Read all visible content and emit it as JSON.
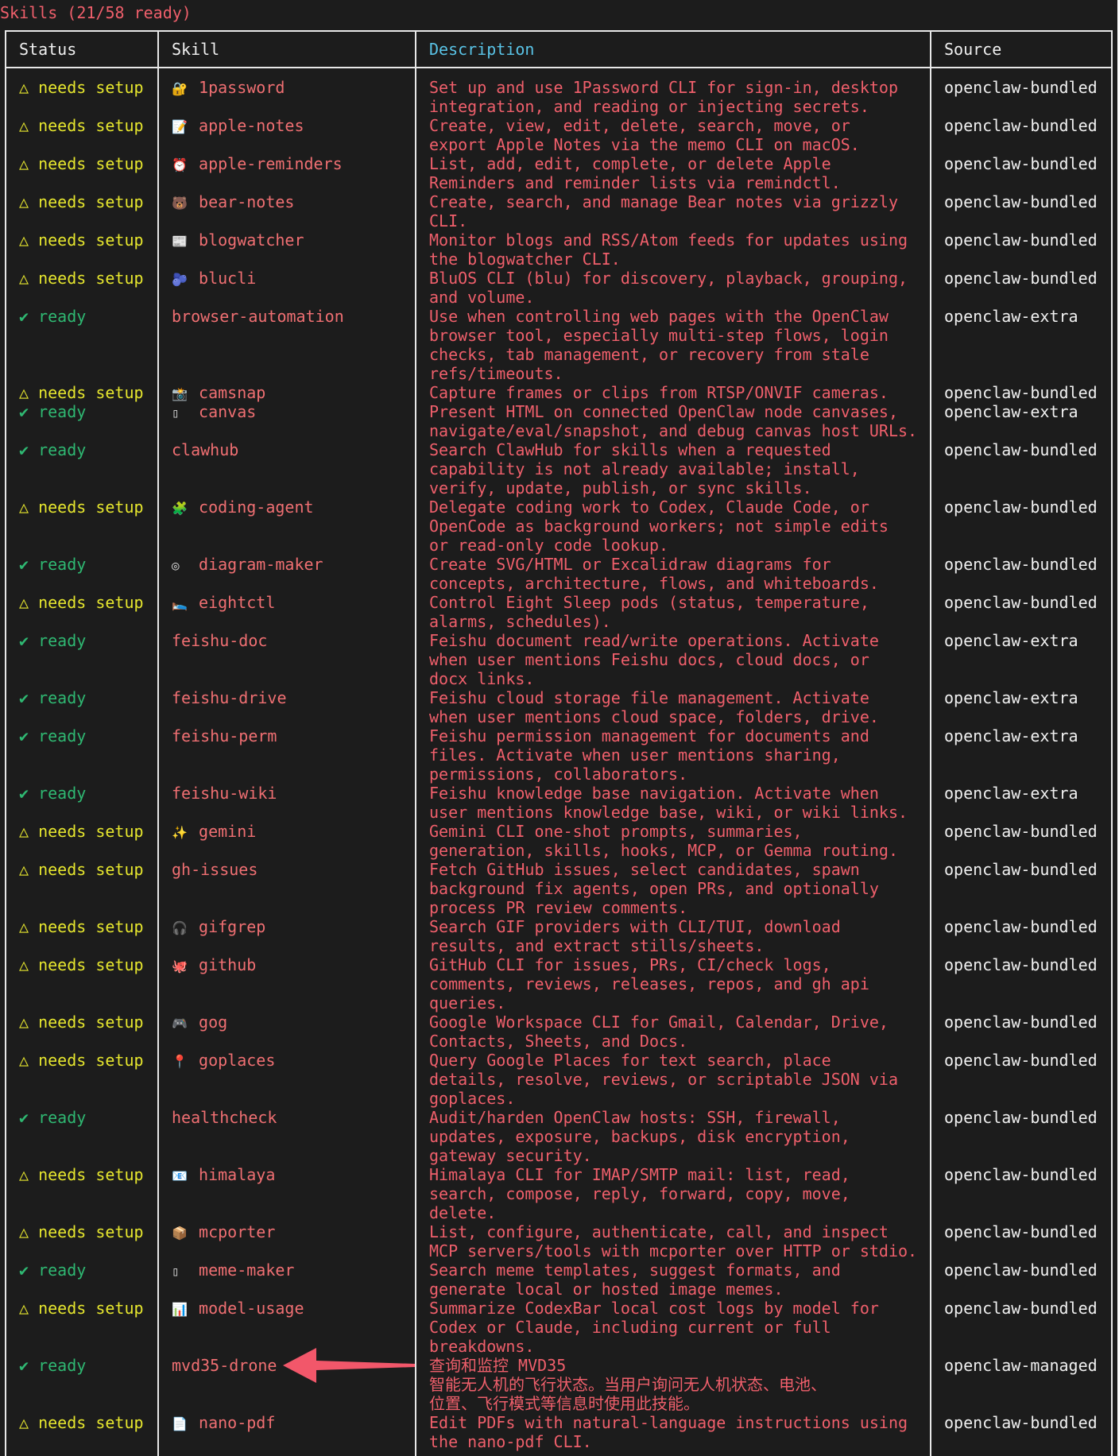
{
  "title": "Skills (21/58 ready)",
  "colors": {
    "ready": "#2fb872",
    "setup": "#e6e62e",
    "text_red": "#ef5f6b",
    "header_blue": "#59c3e6",
    "white": "#f0f0f0"
  },
  "headers": {
    "status": "Status",
    "skill": "Skill",
    "description": "Description",
    "source": "Source"
  },
  "rows": [
    {
      "status": "△ needs setup",
      "icon": "🔐",
      "icon_name": "lock-key-icon",
      "skill": "1password",
      "desc": "Set up and use 1Password CLI for sign-in, desktop\nintegration, and reading or injecting secrets.",
      "source": "openclaw-bundled"
    },
    {
      "status": "△ needs setup",
      "icon": "📝",
      "icon_name": "memo-icon",
      "skill": "apple-notes",
      "desc": "Create, view, edit, delete, search, move, or\nexport Apple Notes via the memo CLI on macOS.",
      "source": "openclaw-bundled"
    },
    {
      "status": "△ needs setup",
      "icon": "⏰",
      "icon_name": "alarm-clock-icon",
      "skill": "apple-reminders",
      "desc": "List, add, edit, complete, or delete Apple\nReminders and reminder lists via remindctl.",
      "source": "openclaw-bundled"
    },
    {
      "status": "△ needs setup",
      "icon": "🐻",
      "icon_name": "bear-icon",
      "skill": "bear-notes",
      "desc": "Create, search, and manage Bear notes via grizzly\nCLI.",
      "source": "openclaw-bundled"
    },
    {
      "status": "△ needs setup",
      "icon": "📰",
      "icon_name": "newspaper-icon",
      "skill": "blogwatcher",
      "desc": "Monitor blogs and RSS/Atom feeds for updates using\nthe blogwatcher CLI.",
      "source": "openclaw-bundled"
    },
    {
      "status": "△ needs setup",
      "icon": "🫐",
      "icon_name": "blueberries-icon",
      "skill": "blucli",
      "desc": "BluOS CLI (blu) for discovery, playback, grouping,\nand volume.",
      "source": "openclaw-bundled"
    },
    {
      "status": "✔ ready",
      "icon": "",
      "icon_name": "",
      "skill": "browser-automation",
      "desc": "Use when controlling web pages with the OpenClaw\nbrowser tool, especially multi-step flows, login\nchecks, tab management, or recovery from stale\nrefs/timeouts.",
      "source": "openclaw-extra"
    },
    {
      "status": "△ needs setup",
      "icon": "📸",
      "icon_name": "camera-icon",
      "skill": "camsnap",
      "desc": "Capture frames or clips from RTSP/ONVIF cameras.",
      "source": "openclaw-bundled"
    },
    {
      "status": "✔ ready",
      "icon": "▯",
      "icon_name": "canvas-icon",
      "skill": "canvas",
      "desc": "Present HTML on connected OpenClaw node canvases,\nnavigate/eval/snapshot, and debug canvas host URLs.",
      "source": "openclaw-extra"
    },
    {
      "status": "✔ ready",
      "icon": "",
      "icon_name": "",
      "skill": "clawhub",
      "desc": "Search ClawHub for skills when a requested\ncapability is not already available; install,\nverify, update, publish, or sync skills.",
      "source": "openclaw-bundled"
    },
    {
      "status": "△ needs setup",
      "icon": "🧩",
      "icon_name": "puzzle-icon",
      "skill": "coding-agent",
      "desc": "Delegate coding work to Codex, Claude Code, or\nOpenCode as background workers; not simple edits\nor read-only code lookup.",
      "source": "openclaw-bundled"
    },
    {
      "status": "✔ ready",
      "icon": "◎",
      "icon_name": "target-icon",
      "skill": "diagram-maker",
      "desc": "Create SVG/HTML or Excalidraw diagrams for\nconcepts, architecture, flows, and whiteboards.",
      "source": "openclaw-bundled"
    },
    {
      "status": "△ needs setup",
      "icon": "🛌",
      "icon_name": "bed-icon",
      "skill": "eightctl",
      "desc": "Control Eight Sleep pods (status, temperature,\nalarms, schedules).",
      "source": "openclaw-bundled"
    },
    {
      "status": "✔ ready",
      "icon": "",
      "icon_name": "",
      "skill": "feishu-doc",
      "desc": "Feishu document read/write operations. Activate\nwhen user mentions Feishu docs, cloud docs, or\ndocx links.",
      "source": "openclaw-extra"
    },
    {
      "status": "✔ ready",
      "icon": "",
      "icon_name": "",
      "skill": "feishu-drive",
      "desc": "Feishu cloud storage file management. Activate\nwhen user mentions cloud space, folders, drive.",
      "source": "openclaw-extra"
    },
    {
      "status": "✔ ready",
      "icon": "",
      "icon_name": "",
      "skill": "feishu-perm",
      "desc": "Feishu permission management for documents and\nfiles. Activate when user mentions sharing,\npermissions, collaborators.",
      "source": "openclaw-extra"
    },
    {
      "status": "✔ ready",
      "icon": "",
      "icon_name": "",
      "skill": "feishu-wiki",
      "desc": "Feishu knowledge base navigation. Activate when\nuser mentions knowledge base, wiki, or wiki links.",
      "source": "openclaw-extra"
    },
    {
      "status": "△ needs setup",
      "icon": "✨",
      "icon_name": "sparkles-icon",
      "skill": "gemini",
      "desc": "Gemini CLI one-shot prompts, summaries,\ngeneration, skills, hooks, MCP, or Gemma routing.",
      "source": "openclaw-bundled"
    },
    {
      "status": "△ needs setup",
      "icon": "",
      "icon_name": "",
      "skill": "gh-issues",
      "desc": "Fetch GitHub issues, select candidates, spawn\nbackground fix agents, open PRs, and optionally\nprocess PR review comments.",
      "source": "openclaw-bundled"
    },
    {
      "status": "△ needs setup",
      "icon": "🎧",
      "icon_name": "headphones-icon",
      "skill": "gifgrep",
      "desc": "Search GIF providers with CLI/TUI, download\nresults, and extract stills/sheets.",
      "source": "openclaw-bundled"
    },
    {
      "status": "△ needs setup",
      "icon": "🐙",
      "icon_name": "octopus-icon",
      "skill": "github",
      "desc": "GitHub CLI for issues, PRs, CI/check logs,\ncomments, reviews, releases, repos, and gh api\nqueries.",
      "source": "openclaw-bundled"
    },
    {
      "status": "△ needs setup",
      "icon": "🎮",
      "icon_name": "gamepad-icon",
      "skill": "gog",
      "desc": "Google Workspace CLI for Gmail, Calendar, Drive,\nContacts, Sheets, and Docs.",
      "source": "openclaw-bundled"
    },
    {
      "status": "△ needs setup",
      "icon": "📍",
      "icon_name": "pin-icon",
      "skill": "goplaces",
      "desc": "Query Google Places for text search, place\ndetails, resolve, reviews, or scriptable JSON via\ngoplaces.",
      "source": "openclaw-bundled"
    },
    {
      "status": "✔ ready",
      "icon": "",
      "icon_name": "",
      "skill": "healthcheck",
      "desc": "Audit/harden OpenClaw hosts: SSH, firewall,\nupdates, exposure, backups, disk encryption,\ngateway security.",
      "source": "openclaw-bundled"
    },
    {
      "status": "△ needs setup",
      "icon": "📧",
      "icon_name": "envelope-icon",
      "skill": "himalaya",
      "desc": "Himalaya CLI for IMAP/SMTP mail: list, read,\nsearch, compose, reply, forward, copy, move,\ndelete.",
      "source": "openclaw-bundled"
    },
    {
      "status": "△ needs setup",
      "icon": "📦",
      "icon_name": "package-icon",
      "skill": "mcporter",
      "desc": "List, configure, authenticate, call, and inspect\nMCP servers/tools with mcporter over HTTP or stdio.",
      "source": "openclaw-bundled"
    },
    {
      "status": "✔ ready",
      "icon": "▯",
      "icon_name": "canvas-icon",
      "skill": "meme-maker",
      "desc": "Search meme templates, suggest formats, and\ngenerate local or hosted image memes.",
      "source": "openclaw-bundled"
    },
    {
      "status": "△ needs setup",
      "icon": "📊",
      "icon_name": "bar-chart-icon",
      "skill": "model-usage",
      "desc": "Summarize CodexBar local cost logs by model for\nCodex or Claude, including current or full\nbreakdowns.",
      "source": "openclaw-bundled"
    },
    {
      "status": "✔ ready",
      "icon": "",
      "icon_name": "",
      "skill": "mvd35-drone",
      "desc": "查询和监控 MVD35\n智能无人机的飞行状态。当用户询问无人机状态、电池、\n位置、飞行模式等信息时使用此技能。",
      "source": "openclaw-managed"
    },
    {
      "status": "△ needs setup",
      "icon": "📄",
      "icon_name": "document-icon",
      "skill": "nano-pdf",
      "desc": "Edit PDFs with natural-language instructions using\nthe nano-pdf CLI.",
      "source": "openclaw-bundled"
    }
  ]
}
